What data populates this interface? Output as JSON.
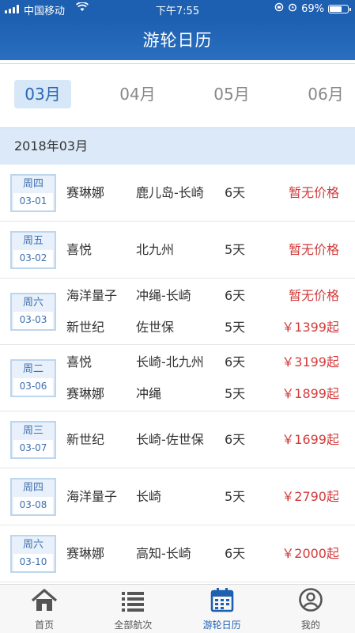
{
  "status": {
    "carrier": "中国移动",
    "time": "下午7:55",
    "battery": "69%",
    "battery_level": 0.69
  },
  "header": {
    "title": "游轮日历"
  },
  "months": [
    {
      "label": "03月",
      "active": true
    },
    {
      "label": "04月",
      "active": false
    },
    {
      "label": "05月",
      "active": false
    },
    {
      "label": "06月",
      "active": false
    }
  ],
  "section": {
    "title": "2018年03月"
  },
  "rows": [
    {
      "weekday": "周四",
      "date": "03-01",
      "trips": [
        {
          "ship": "赛琳娜",
          "route": "鹿儿岛-长崎",
          "days": "6天",
          "price": "暂无价格"
        }
      ]
    },
    {
      "weekday": "周五",
      "date": "03-02",
      "trips": [
        {
          "ship": "喜悦",
          "route": "北九州",
          "days": "5天",
          "price": "暂无价格"
        }
      ]
    },
    {
      "weekday": "周六",
      "date": "03-03",
      "trips": [
        {
          "ship": "海洋量子",
          "route": "冲绳-长崎",
          "days": "6天",
          "price": "暂无价格"
        },
        {
          "ship": "新世纪",
          "route": "佐世保",
          "days": "5天",
          "price": "￥1399起"
        }
      ]
    },
    {
      "weekday": "周二",
      "date": "03-06",
      "trips": [
        {
          "ship": "喜悦",
          "route": "长崎-北九州",
          "days": "6天",
          "price": "￥3199起"
        },
        {
          "ship": "赛琳娜",
          "route": "冲绳",
          "days": "5天",
          "price": "￥1899起"
        }
      ]
    },
    {
      "weekday": "周三",
      "date": "03-07",
      "trips": [
        {
          "ship": "新世纪",
          "route": "长崎-佐世保",
          "days": "6天",
          "price": "￥1699起"
        }
      ]
    },
    {
      "weekday": "周四",
      "date": "03-08",
      "trips": [
        {
          "ship": "海洋量子",
          "route": "长崎",
          "days": "5天",
          "price": "￥2790起"
        }
      ]
    },
    {
      "weekday": "周六",
      "date": "03-10",
      "trips": [
        {
          "ship": "赛琳娜",
          "route": "高知-长崎",
          "days": "6天",
          "price": "￥2000起"
        }
      ]
    }
  ],
  "tabbar": [
    {
      "label": "首页",
      "icon": "home-icon",
      "active": false
    },
    {
      "label": "全部航次",
      "icon": "list-icon",
      "active": false
    },
    {
      "label": "游轮日历",
      "icon": "calendar-icon",
      "active": true
    },
    {
      "label": "我的",
      "icon": "user-icon",
      "active": false
    }
  ],
  "colors": {
    "primary": "#1d5fb0",
    "price": "#d23b3b",
    "section_bg": "#dbe9f8"
  }
}
